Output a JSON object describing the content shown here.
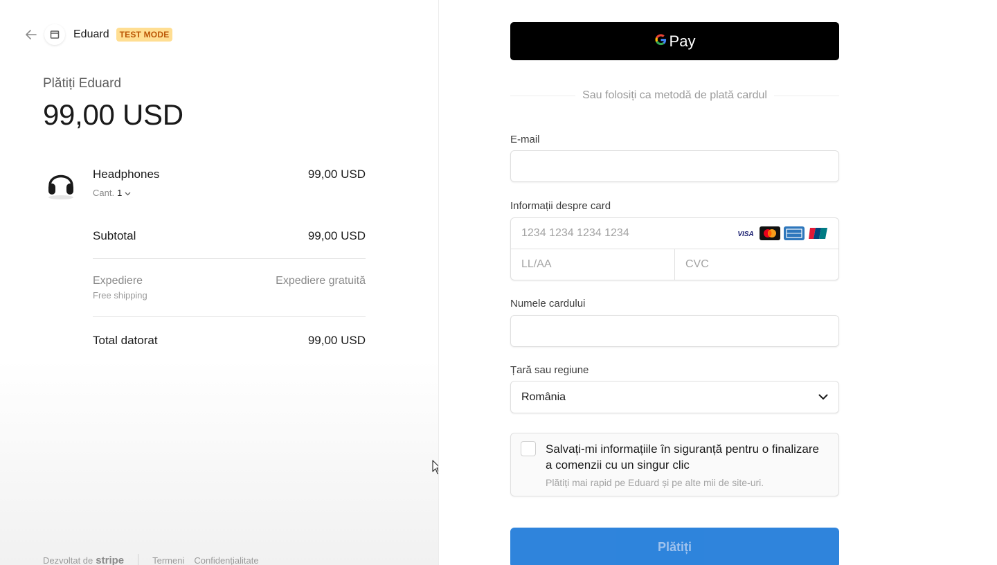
{
  "header": {
    "merchant_name": "Eduard",
    "test_badge": "TEST MODE"
  },
  "summary": {
    "pay_to": "Plătiți Eduard",
    "amount": "99,00 USD"
  },
  "line_item": {
    "name": "Headphones",
    "price": "99,00 USD",
    "qty_label": "Cant.",
    "qty_value": "1"
  },
  "totals": {
    "subtotal_label": "Subtotal",
    "subtotal_value": "99,00 USD",
    "shipping_label": "Expediere",
    "shipping_sub": "Free shipping",
    "shipping_value": "Expediere gratuită",
    "total_label": "Total datorat",
    "total_value": "99,00 USD"
  },
  "footer": {
    "powered_by": "Dezvoltat de",
    "brand": "stripe",
    "terms": "Termeni",
    "privacy": "Confidențialitate"
  },
  "payment": {
    "gpay_label": "Pay",
    "or_text": "Sau folosiți ca metodă de plată cardul",
    "email_label": "E-mail",
    "email_value": "",
    "card_label": "Informații despre card",
    "card_number_placeholder": "1234 1234 1234 1234",
    "expiry_placeholder": "LL/AA",
    "cvc_placeholder": "CVC",
    "card_brands": [
      "visa-icon",
      "mastercard-icon",
      "amex-icon",
      "unionpay-icon"
    ],
    "name_label": "Numele cardului",
    "name_value": "",
    "country_label": "Țară sau regiune",
    "country_value": "România",
    "save_title": "Salvați-mi informațiile în siguranță pentru o finalizare a comenzii cu un singur clic",
    "save_sub": "Plătiți mai rapid pe Eduard și pe alte mii de site-uri.",
    "save_checked": false,
    "pay_button": "Plătiți"
  },
  "colors": {
    "accent": "#0a6fd6",
    "badge_bg": "#ffde92",
    "badge_text": "#bb5504"
  }
}
